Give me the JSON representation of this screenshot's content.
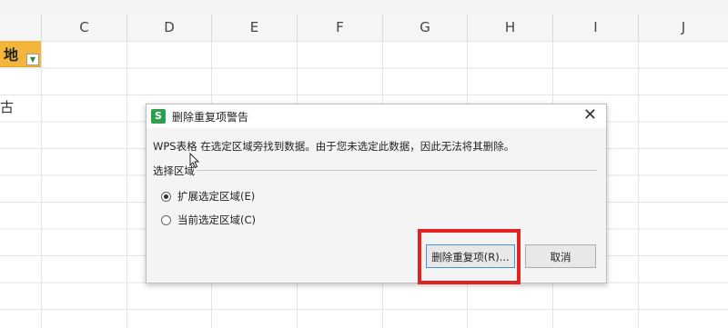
{
  "columns": [
    "C",
    "D",
    "E",
    "F",
    "G",
    "H",
    "I",
    "J"
  ],
  "b_column": {
    "header": "地",
    "filter_icon": "filter-dropdown-icon",
    "cells": [
      "古"
    ]
  },
  "dialog": {
    "app_icon": "S",
    "title": "删除重复项警告",
    "close_icon": "close-icon",
    "message": "WPS表格 在选定区域旁找到数据。由于您未选定此数据，因此无法将其删除。",
    "section_label": "选择区域",
    "options": [
      {
        "label": "扩展选定区域(E)",
        "checked": true
      },
      {
        "label": "当前选定区域(C)",
        "checked": false
      }
    ],
    "remove_button": "删除重复项(R)...",
    "cancel_button": "取消"
  },
  "colors": {
    "header_fill": "#f3b63a",
    "highlight": "#e32222",
    "app_icon": "#2e9e4f"
  }
}
